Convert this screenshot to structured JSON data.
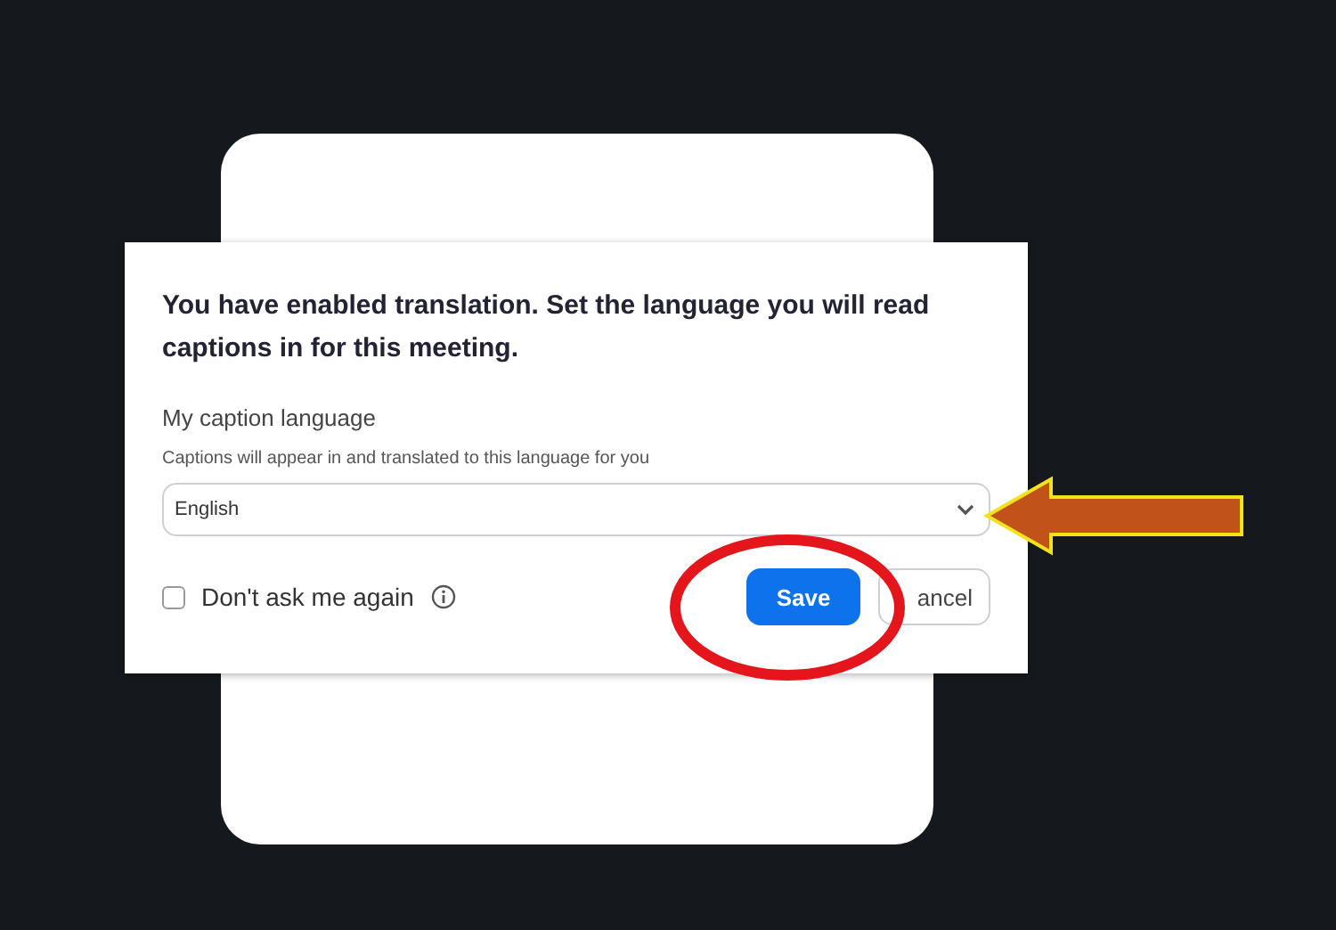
{
  "dialog": {
    "title": "You have enabled translation. Set the language you will read captions in for this meeting.",
    "field_label": "My caption language",
    "field_hint": "Captions will appear in and translated to this language for you",
    "language_select": {
      "value": "English"
    },
    "dont_ask_again": {
      "label": "Don't ask me again",
      "checked": false
    },
    "buttons": [
      {
        "label": "Save",
        "kind": "primary"
      },
      {
        "label": "ancel",
        "kind": "secondary"
      }
    ]
  }
}
